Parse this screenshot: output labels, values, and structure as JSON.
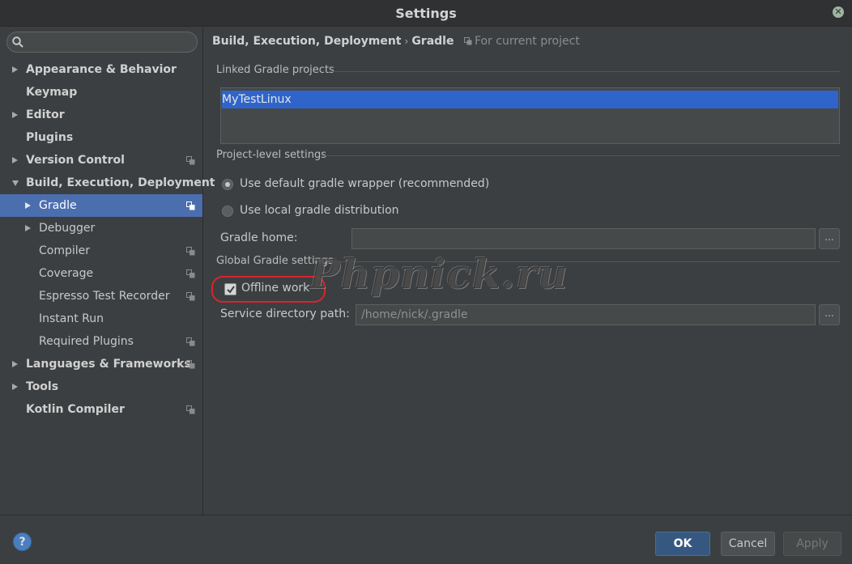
{
  "window": {
    "title": "Settings",
    "close_glyph": "✕"
  },
  "search": {
    "value": "",
    "placeholder": ""
  },
  "sidebar": {
    "items": [
      {
        "label": "Appearance & Behavior",
        "bold": true,
        "arrow": "right",
        "level": 0,
        "project": false
      },
      {
        "label": "Keymap",
        "bold": true,
        "arrow": "none",
        "level": 0,
        "project": false
      },
      {
        "label": "Editor",
        "bold": true,
        "arrow": "right",
        "level": 0,
        "project": false
      },
      {
        "label": "Plugins",
        "bold": true,
        "arrow": "none",
        "level": 0,
        "project": false
      },
      {
        "label": "Version Control",
        "bold": true,
        "arrow": "right",
        "level": 0,
        "project": true
      },
      {
        "label": "Build, Execution, Deployment",
        "bold": true,
        "arrow": "down",
        "level": 0,
        "project": false
      },
      {
        "label": "Gradle",
        "bold": false,
        "arrow": "right",
        "level": 1,
        "project": true,
        "selected": true
      },
      {
        "label": "Debugger",
        "bold": false,
        "arrow": "right",
        "level": 1,
        "project": false
      },
      {
        "label": "Compiler",
        "bold": false,
        "arrow": "none",
        "level": 1,
        "project": true
      },
      {
        "label": "Coverage",
        "bold": false,
        "arrow": "none",
        "level": 1,
        "project": true
      },
      {
        "label": "Espresso Test Recorder",
        "bold": false,
        "arrow": "none",
        "level": 1,
        "project": true
      },
      {
        "label": "Instant Run",
        "bold": false,
        "arrow": "none",
        "level": 1,
        "project": false
      },
      {
        "label": "Required Plugins",
        "bold": false,
        "arrow": "none",
        "level": 1,
        "project": true
      },
      {
        "label": "Languages & Frameworks",
        "bold": true,
        "arrow": "right",
        "level": 0,
        "project": true
      },
      {
        "label": "Tools",
        "bold": true,
        "arrow": "right",
        "level": 0,
        "project": false
      },
      {
        "label": "Kotlin Compiler",
        "bold": true,
        "arrow": "none",
        "level": 0,
        "project": true
      }
    ]
  },
  "breadcrumb": {
    "parent": "Build, Execution, Deployment",
    "separator": "›",
    "current": "Gradle",
    "scope": "For current project"
  },
  "linked": {
    "title": "Linked Gradle projects",
    "projects": [
      "MyTestLinux"
    ]
  },
  "project_level": {
    "title": "Project-level settings",
    "options": [
      {
        "label": "Use default gradle wrapper (recommended)",
        "checked": true
      },
      {
        "label": "Use local gradle distribution",
        "checked": false
      }
    ],
    "gradle_home_label": "Gradle home:",
    "gradle_home_value": "",
    "browse_label": "..."
  },
  "global": {
    "title": "Global Gradle settings",
    "offline_label": "Offline work",
    "offline_checked": true,
    "service_dir_label": "Service directory path:",
    "service_dir_value": "/home/nick/.gradle",
    "browse_label": "..."
  },
  "watermark": "Phpnick.ru",
  "footer": {
    "help_label": "?",
    "ok_label": "OK",
    "cancel_label": "Cancel",
    "apply_label": "Apply"
  },
  "colors": {
    "selection": "#4b6eaf",
    "list_selection": "#2f65ca",
    "highlight_ring": "#d9242b",
    "ok_button": "#365880"
  }
}
